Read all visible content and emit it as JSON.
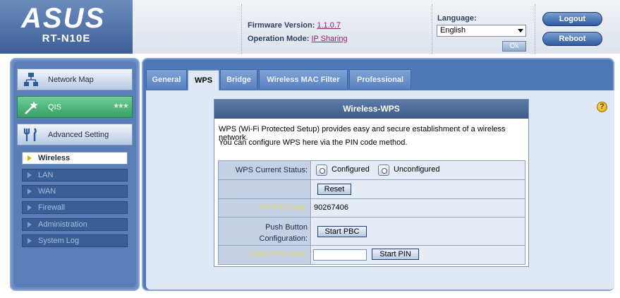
{
  "header": {
    "brand": "ASUS",
    "model": "RT-N10E",
    "firmware_label": "Firmware Version:",
    "firmware_value": "1.1.0.7",
    "mode_label": "Operation Mode:",
    "mode_value": "IP Sharing",
    "language_label": "Language:",
    "language_value": "English",
    "ok_label": "Ok",
    "logout_label": "Logout",
    "reboot_label": "Reboot"
  },
  "sidebar": {
    "menu": [
      {
        "label": "Network Map",
        "icon": "network-map-icon"
      },
      {
        "label": "QIS",
        "icon": "wizard-wand-icon"
      },
      {
        "label": "Advanced Setting",
        "icon": "tools-icon"
      }
    ],
    "submenu": [
      "Wireless",
      "LAN",
      "WAN",
      "Firewall",
      "Administration",
      "System Log"
    ]
  },
  "tabs": [
    "General",
    "WPS",
    "Bridge",
    "Wireless MAC Filter",
    "Professional"
  ],
  "wps": {
    "title": "Wireless-WPS",
    "desc1": "WPS (Wi-Fi Protected Setup) provides easy and secure establishment of a wireless network.",
    "desc2": "You can configure WPS here via the PIN code method.",
    "status_label": "WPS Current Status:",
    "configured_label": "Configured",
    "unconfigured_label": "Unconfigured",
    "reset_label": "Reset",
    "ap_pin_label": "AP PIN Code:",
    "ap_pin_value": "90267406",
    "push_label_1": "Push Button",
    "push_label_2": "Configuration:",
    "start_pbc_label": "Start PBC",
    "client_pin_label": "Client PIN Code:",
    "client_pin_value": "",
    "start_pin_label": "Start PIN"
  },
  "colors": {
    "accent_blue": "#4f78b7",
    "qis_green": "#36a064",
    "label_yellow": "#e7d46a"
  }
}
